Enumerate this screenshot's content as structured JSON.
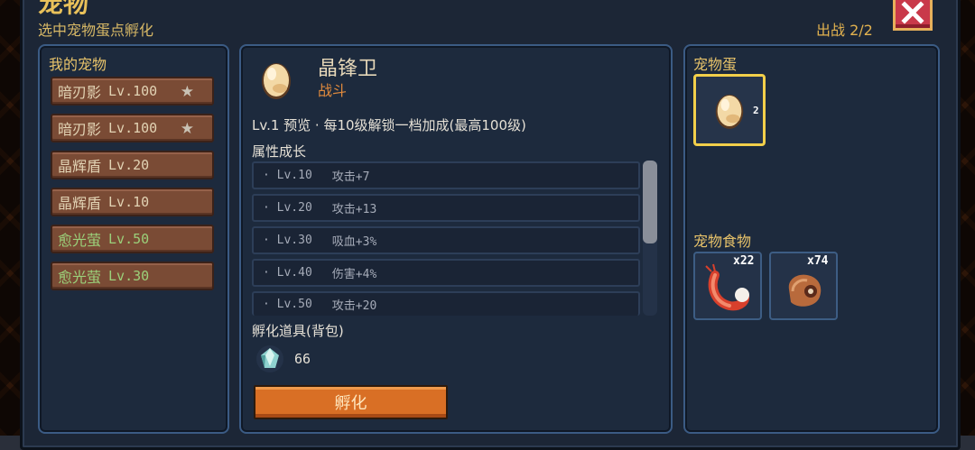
{
  "window": {
    "title": "宠物",
    "subtitle": "选中宠物蛋点孵化",
    "deploy_label": "出战 2/2"
  },
  "my_pets": {
    "title": "我的宠物",
    "items": [
      {
        "name": "暗刃影",
        "level": "Lv.100",
        "starred": true,
        "color": "#e2d3b4"
      },
      {
        "name": "暗刃影",
        "level": "Lv.100",
        "starred": true,
        "color": "#e2d3b4"
      },
      {
        "name": "晶辉盾",
        "level": "Lv.20",
        "starred": false,
        "color": "#e2d3b4"
      },
      {
        "name": "晶辉盾",
        "level": "Lv.10",
        "starred": false,
        "color": "#e2d3b4"
      },
      {
        "name": "愈光萤",
        "level": "Lv.50",
        "starred": false,
        "color": "#9bd07a"
      },
      {
        "name": "愈光萤",
        "level": "Lv.30",
        "starred": false,
        "color": "#9bd07a"
      }
    ]
  },
  "detail": {
    "name": "晶锋卫",
    "type": "战斗",
    "level_line": "Lv.1 预览 · 每10级解锁一档加成(最高100级)",
    "growth_title": "属性成长",
    "stats": [
      {
        "level": "· Lv.10",
        "attr": "攻击+7"
      },
      {
        "level": "· Lv.20",
        "attr": "攻击+13"
      },
      {
        "level": "· Lv.30",
        "attr": "吸血+3%"
      },
      {
        "level": "· Lv.40",
        "attr": "伤害+4%"
      },
      {
        "level": "· Lv.50",
        "attr": "攻击+20"
      }
    ],
    "items_title": "孵化道具(背包)",
    "gem_count": "66",
    "hatch_label": "孵化"
  },
  "eggs": {
    "title": "宠物蛋",
    "egg_count": "2"
  },
  "food": {
    "title": "宠物食物",
    "items": [
      {
        "icon": "shrimp-icon",
        "count": "x22"
      },
      {
        "icon": "meat-sack-icon",
        "count": "x74"
      }
    ]
  },
  "colors": {
    "accent_gold": "#e8c36a",
    "hatch_orange": "#d96f25",
    "panel_border": "#3b5b84",
    "close_red": "#c9394a"
  }
}
